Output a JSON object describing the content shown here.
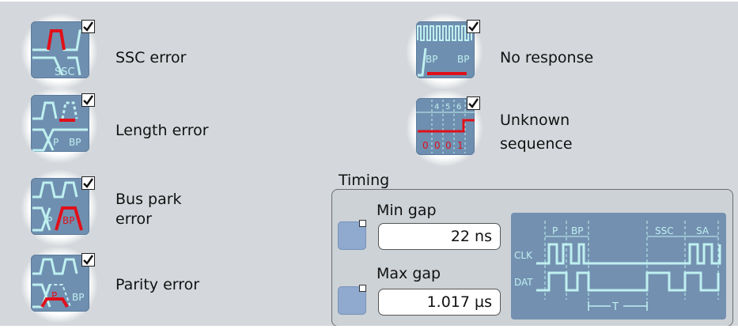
{
  "errors": {
    "ssc": {
      "label": "SSC error",
      "checked": true,
      "tile_text": "SSC"
    },
    "length": {
      "label": "Length error",
      "checked": true,
      "tile_text": [
        "P",
        "BP"
      ]
    },
    "bus_park": {
      "label_line1": "Bus park",
      "label_line2": "error",
      "checked": true,
      "tile_text": [
        "P",
        "BP"
      ]
    },
    "parity": {
      "label": "Parity error",
      "checked": true,
      "tile_text": [
        "P",
        "BP"
      ]
    },
    "no_response": {
      "label": "No response",
      "checked": true,
      "tile_text": [
        "BP",
        "BP"
      ]
    },
    "unknown": {
      "label_line1": "Unknown",
      "label_line2": "sequence",
      "checked": true,
      "tile_top": [
        "4",
        "5",
        "6"
      ],
      "tile_bits": [
        "0",
        "0",
        "0",
        "1"
      ]
    }
  },
  "timing": {
    "title": "Timing",
    "min_gap": {
      "label": "Min gap",
      "value": "22 ns"
    },
    "max_gap": {
      "label": "Max gap",
      "value": "1.017 µs"
    },
    "diagram": {
      "labels": [
        "P",
        "BP",
        "SSC",
        "SA",
        "CLK",
        "DAT",
        "T"
      ]
    }
  },
  "colors": {
    "tile": "#6f8fb0",
    "trace": "#bff0f0",
    "error": "#e0101a",
    "toggle": "#8fa9cf"
  }
}
